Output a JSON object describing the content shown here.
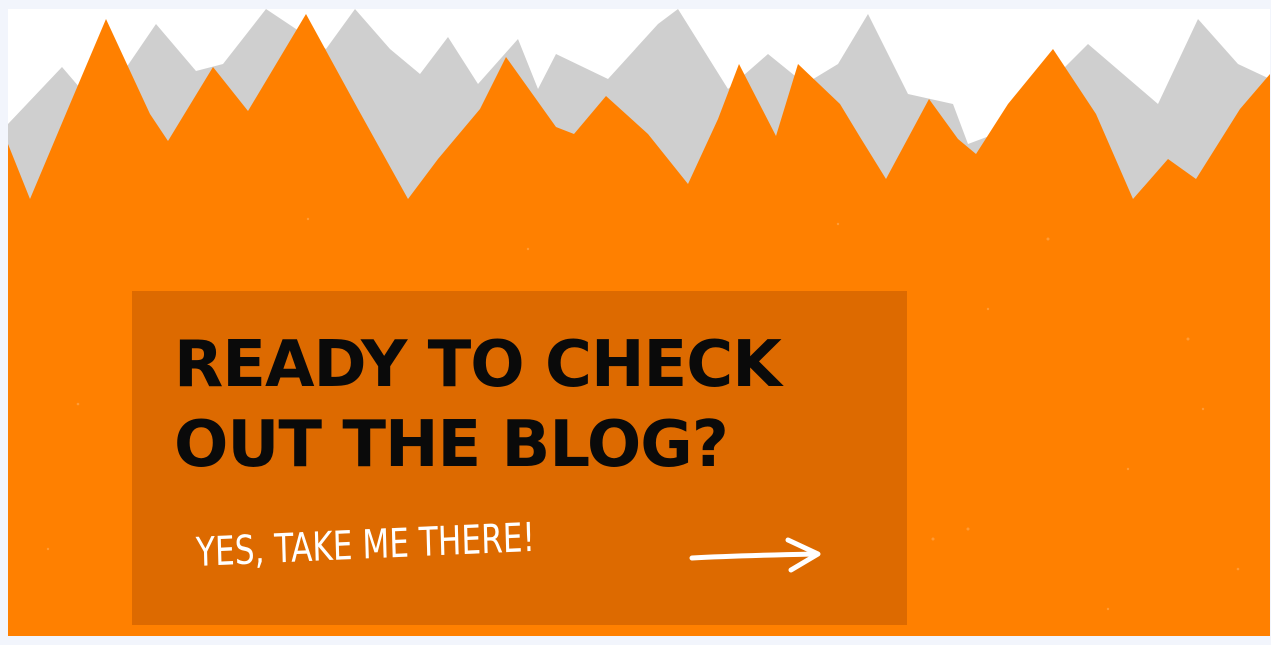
{
  "banner": {
    "headline_line1": "READY TO CHECK",
    "headline_line2": "OUT THE BLOG?",
    "cta_label": "YES, TAKE ME THERE!",
    "cta_icon": "arrow-right-icon"
  },
  "colors": {
    "orange": "#ff8000",
    "orange_dark": "#dd6a00",
    "mountain_gray": "#cfcfcf",
    "sky": "#ffffff",
    "headline_text": "#0a0a0a",
    "cta_text": "#ffffff"
  }
}
